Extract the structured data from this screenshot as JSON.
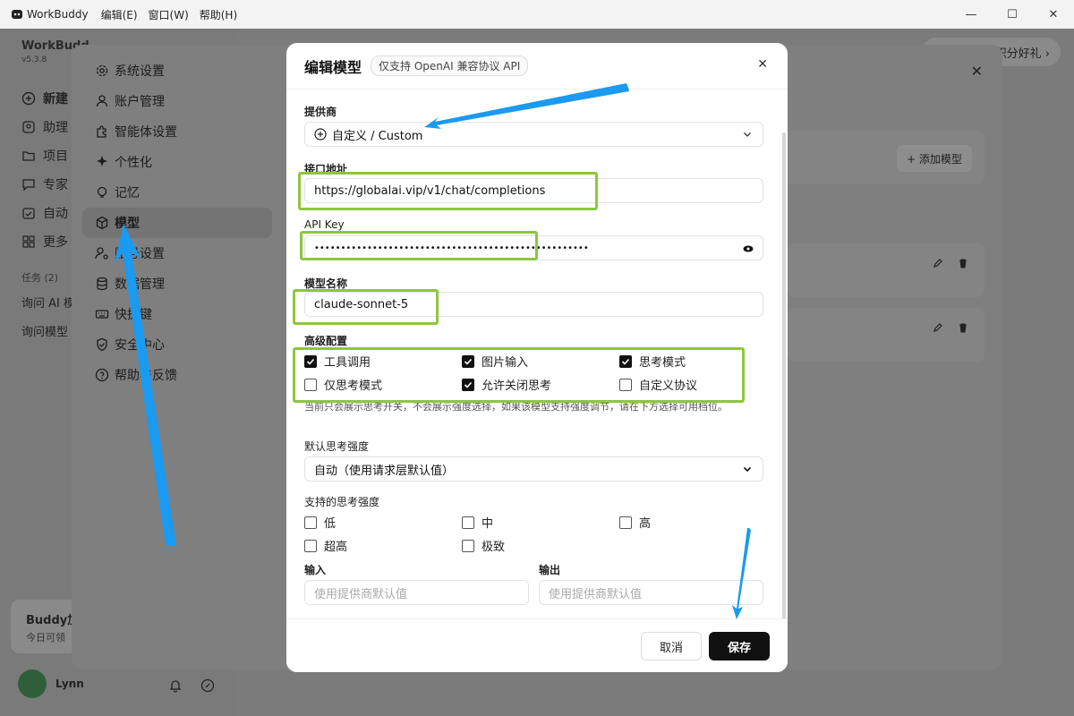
{
  "titlebar": {
    "app_title": "WorkBuddy",
    "menus": [
      "编辑(E)",
      "窗口(W)",
      "帮助(H)"
    ],
    "minimize": "—",
    "maximize": "☐",
    "close": "✕"
  },
  "background": {
    "brand": "WorkBudd",
    "version": "v5.3.8",
    "nav": [
      "新建",
      "助理",
      "项目",
      "专家",
      "自动",
      "更多"
    ],
    "tasks_label": "任务 (2)",
    "tasks": [
      "询问 AI 模",
      "询问模型"
    ],
    "buddy_title": "Buddy加",
    "buddy_sub": "今日可领",
    "user_name": "Lynn",
    "promo": "积分好礼 ›"
  },
  "settings": {
    "nav": [
      {
        "label": "系统设置",
        "icon": "gear-icon"
      },
      {
        "label": "账户管理",
        "icon": "user-icon"
      },
      {
        "label": "智能体设置",
        "icon": "puzzle-icon"
      },
      {
        "label": "个性化",
        "icon": "sparkle-icon"
      },
      {
        "label": "记忆",
        "icon": "bulb-icon"
      },
      {
        "label": "模型",
        "icon": "cube-icon"
      },
      {
        "label": "账号设置",
        "icon": "user-cog-icon"
      },
      {
        "label": "数据管理",
        "icon": "database-icon"
      },
      {
        "label": "快捷键",
        "icon": "keyboard-icon"
      },
      {
        "label": "安全中心",
        "icon": "shield-icon"
      },
      {
        "label": "帮助与反馈",
        "icon": "help-icon"
      }
    ],
    "active_index": 5,
    "add_model": "+ 添加模型"
  },
  "modal": {
    "title": "编辑模型",
    "badge": "仅支持 OpenAI 兼容协议 API",
    "provider_label": "提供商",
    "provider_value": "自定义 / Custom",
    "endpoint_label": "接口地址",
    "endpoint_value": "https://globalai.vip/v1/chat/completions",
    "apikey_label": "API Key",
    "apikey_value": "••••••••••••••••••••••••••••••••••••••••••••••••••••",
    "model_name_label": "模型名称",
    "model_name_value": "claude-sonnet-5",
    "advanced_label": "高级配置",
    "advanced": [
      {
        "label": "工具调用",
        "checked": true
      },
      {
        "label": "图片输入",
        "checked": true
      },
      {
        "label": "思考模式",
        "checked": true
      },
      {
        "label": "仅思考模式",
        "checked": false
      },
      {
        "label": "允许关闭思考",
        "checked": true
      },
      {
        "label": "自定义协议",
        "checked": false
      }
    ],
    "hint": "当前只会展示思考开关，不会展示强度选择，如果该模型支持强度调节，请在下方选择可用档位。",
    "default_intensity_label": "默认思考强度",
    "default_intensity_value": "自动（使用请求层默认值）",
    "supported_intensity_label": "支持的思考强度",
    "intensities": [
      {
        "label": "低",
        "checked": false
      },
      {
        "label": "中",
        "checked": false
      },
      {
        "label": "高",
        "checked": false
      },
      {
        "label": "超高",
        "checked": false
      },
      {
        "label": "极致",
        "checked": false
      }
    ],
    "input_label": "输入",
    "output_label": "输出",
    "input_placeholder": "使用提供商默认值",
    "output_placeholder": "使用提供商默认值",
    "cancel": "取消",
    "save": "保存"
  },
  "colors": {
    "annotation_green": "#8dc63f",
    "annotation_arrow": "#1a9af0",
    "primary_button": "#111111"
  }
}
